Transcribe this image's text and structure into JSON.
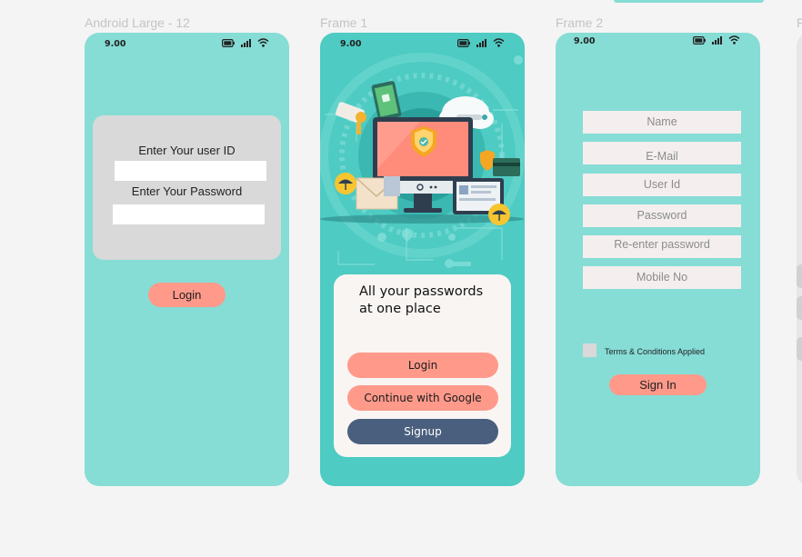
{
  "frames": [
    {
      "label": "Android Large - 12",
      "time": "9.00"
    },
    {
      "label": "Frame 1",
      "time": "9.00"
    },
    {
      "label": "Frame 2",
      "time": "9.00"
    },
    {
      "label": "F"
    }
  ],
  "login_screen": {
    "user_id_label": "Enter Your user ID",
    "password_label": "Enter Your Password",
    "login_button": "Login"
  },
  "welcome_screen": {
    "headline": "All your passwords at one place",
    "login_button": "Login",
    "google_button": "Continue with Google",
    "signup_button": "Signup"
  },
  "signup_screen": {
    "fields": {
      "name": "Name",
      "email": "E-Mail",
      "user_id": "User Id",
      "password": "Password",
      "reenter_password": "Re-enter password",
      "mobile": "Mobile No"
    },
    "terms_label": "Terms  & Conditions Applied",
    "sign_in_button": "Sign In"
  },
  "colors": {
    "teal_light": "#86ddd5",
    "teal_dark": "#4ecbc3",
    "salmon": "#ff9a8b",
    "navy": "#4a5f7e",
    "card_grey": "#d9d9d9"
  }
}
